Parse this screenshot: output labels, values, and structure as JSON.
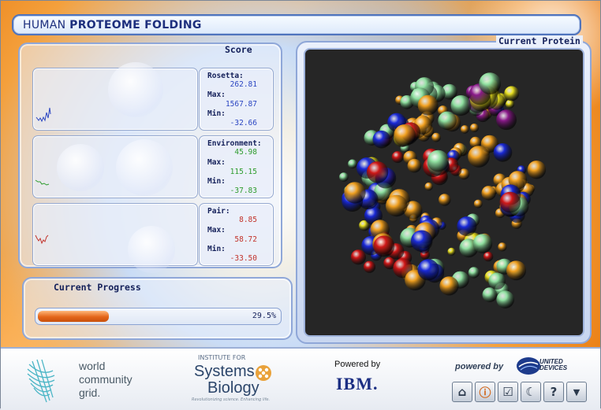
{
  "app": {
    "title_prefix": "HUMAN ",
    "title_bold": "PROTEOME FOLDING"
  },
  "score": {
    "title": "Score",
    "rows": [
      {
        "label": "Rosetta:",
        "value": "262.81",
        "max_label": "Max:",
        "max": "1567.87",
        "min_label": "Min:",
        "min": "-32.66",
        "color": "#2b46c2"
      },
      {
        "label": "Environment:",
        "value": "45.98",
        "max_label": "Max:",
        "max": "115.15",
        "min_label": "Min:",
        "min": "-37.83",
        "color": "#2e9c2e"
      },
      {
        "label": "Pair:",
        "value": "8.85",
        "max_label": "Max:",
        "max": "58.72",
        "min_label": "Min:",
        "min": "-33.50",
        "color": "#c2332b"
      }
    ]
  },
  "progress": {
    "title": "Current Progress",
    "percent_label": "29.5%",
    "fraction": 0.295
  },
  "protein": {
    "title": "Current Protein"
  },
  "footer": {
    "wcg": {
      "line1": "world",
      "line2": "community",
      "line3": "grid."
    },
    "isb": {
      "small": "INSTITUTE FOR",
      "line1": "Systems",
      "line2": "Biology",
      "tagline": "Revolutionizing science. Enhancing life."
    },
    "ibm": {
      "powered": "Powered by",
      "logo": "IBM."
    },
    "ud": {
      "powered": "powered by",
      "brand1": "UNITED",
      "brand2": "DEVICES"
    }
  },
  "toolbar": {
    "buttons": [
      {
        "icon": "home-icon",
        "glyph": "⌂"
      },
      {
        "icon": "info-icon",
        "glyph": "ⓘ"
      },
      {
        "icon": "checkmark-icon",
        "glyph": "☑"
      },
      {
        "icon": "moon-icon",
        "glyph": "☾"
      },
      {
        "icon": "help-icon",
        "glyph": "?"
      },
      {
        "icon": "dropdown-arrow-icon",
        "glyph": "▼"
      }
    ]
  },
  "colors": {
    "accent_orange": "#e8780c",
    "frame_blue": "#4f74bd",
    "atom_orange": "#f0a020",
    "atom_green": "#8fe0a0",
    "atom_red": "#d01818",
    "atom_blue": "#1a2ad8",
    "atom_purple": "#8a1a8a",
    "atom_yellow": "#e8e020"
  }
}
